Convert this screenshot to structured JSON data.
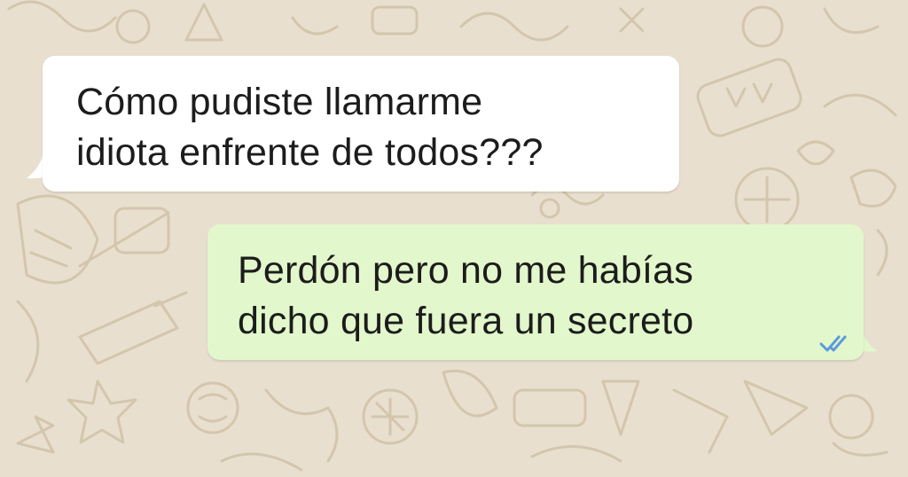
{
  "chat": {
    "messages": [
      {
        "direction": "incoming",
        "lines": [
          "Cómo pudiste llamarme",
          "idiota enfrente de todos???"
        ]
      },
      {
        "direction": "outgoing",
        "lines": [
          "Perdón pero no me habías",
          "dicho que fuera un secreto"
        ],
        "status_icon": "double-check-read-icon"
      }
    ]
  },
  "colors": {
    "wallpaper": "#e9dfcf",
    "doodles": "#d4c6ad",
    "incoming_bubble": "#ffffff",
    "outgoing_bubble": "#e2f7cb",
    "read_ticks": "#5b9bd9",
    "text": "#1c1c1c"
  }
}
